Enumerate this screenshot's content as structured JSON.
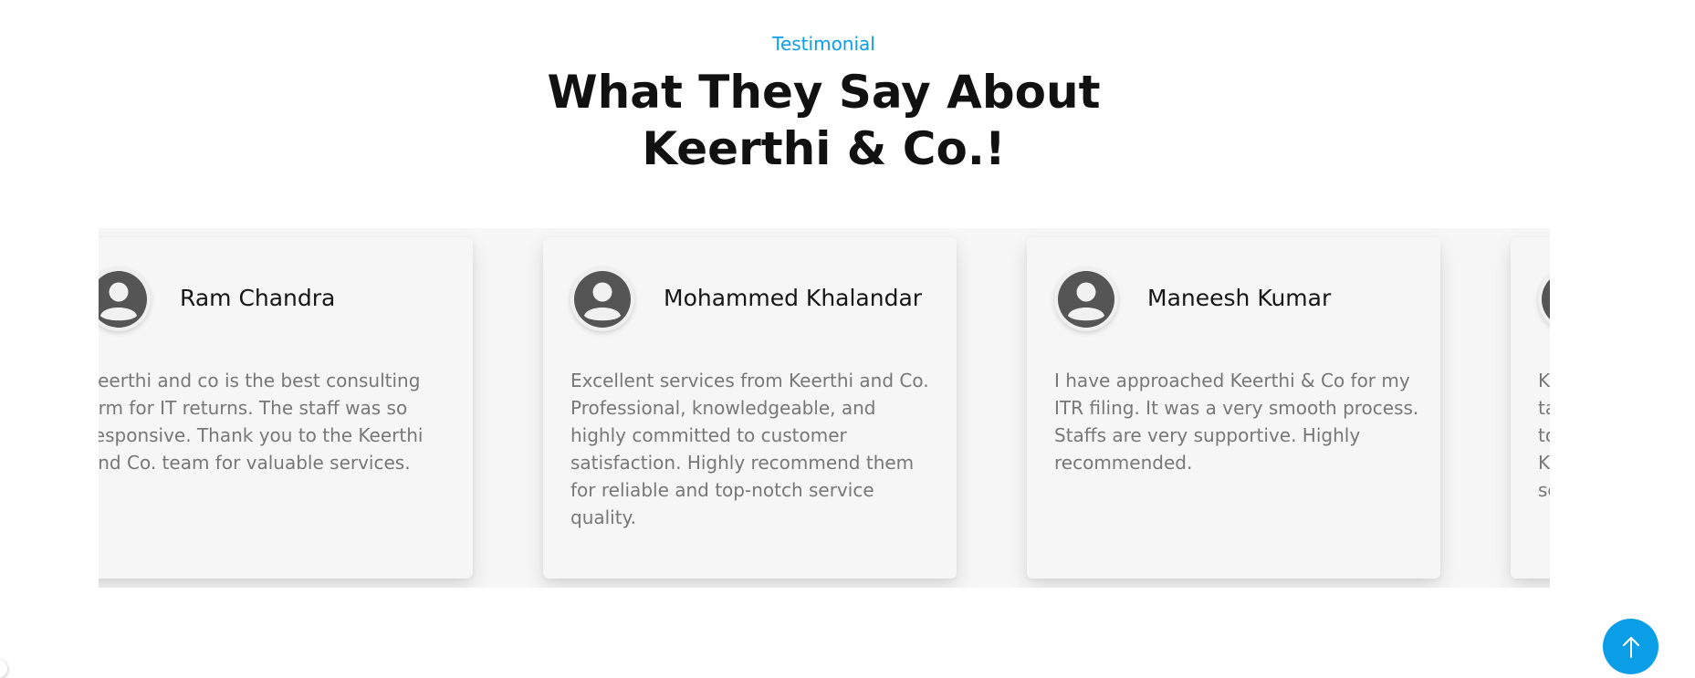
{
  "header": {
    "eyebrow": "Testimonial",
    "title_line1": "What They Say About",
    "title_line2": "Keerthi & Co.!"
  },
  "testimonials": [
    {
      "name": "Ram Chandra",
      "text": "Keerthi and co is the best consulting firm for IT returns. The staff was so responsive. Thank you to the Keerthi and Co. team for valuable services."
    },
    {
      "name": "Mohammed Khalandar",
      "text": "Excellent services from Keerthi and Co. Professional, knowledgeable, and highly committed to customer satisfaction. Highly recommend them for reliable and top-notch service quality."
    },
    {
      "name": "Maneesh Kumar",
      "text": "I have approached Keerthi & Co for my ITR filing. It was a very smooth process. Staffs are very supportive. Highly recommended."
    },
    {
      "name": "",
      "text": "K ta to K se"
    }
  ],
  "icons": {
    "avatar": "user-avatar-icon",
    "back_to_top": "arrow-up-icon"
  },
  "colors": {
    "accent": "#0a9ee6",
    "heading": "#111111",
    "body_text": "#777777",
    "card_bg": "#f6f6f6"
  }
}
